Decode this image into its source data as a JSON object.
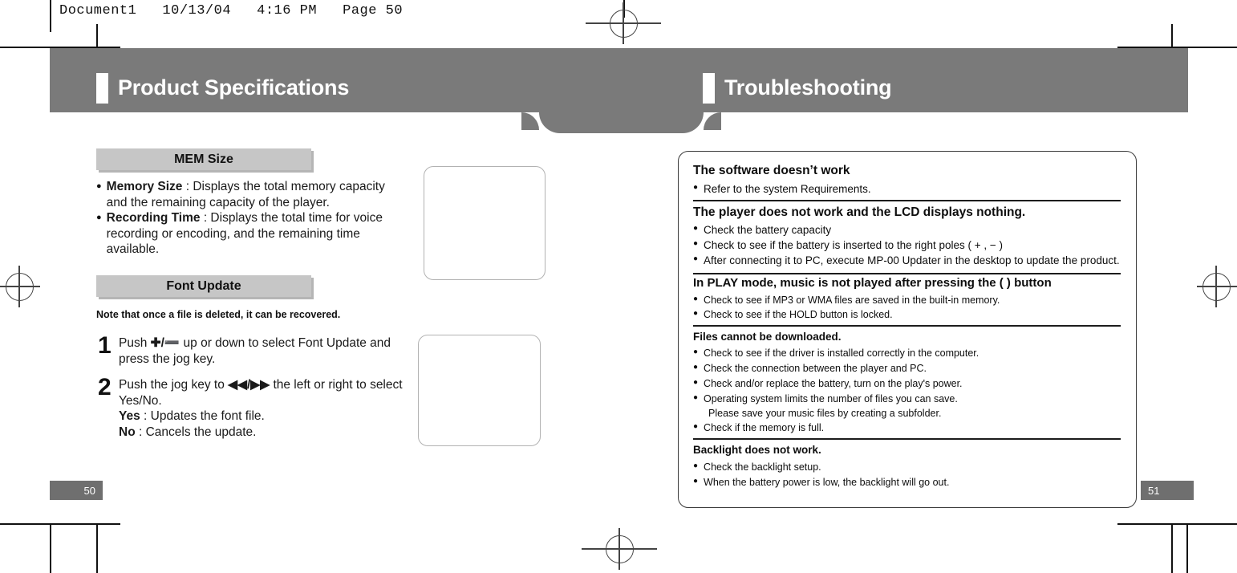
{
  "proof_header": {
    "text": "Document1   10/13/04   4:16 PM   Page 50"
  },
  "banner": {
    "left_title": "Product Specifications",
    "right_title": "Troubleshooting",
    "color": "#7a7a7a"
  },
  "left_page": {
    "page_number": "50",
    "sections": [
      {
        "heading": "MEM Size",
        "bullets": [
          {
            "dot": "●",
            "bold": "Memory Size",
            "rest": " : Displays the total memory capacity and the remaining capacity of the player."
          },
          {
            "dot": "●",
            "bold": "Recording Time",
            "rest": " : Displays the total time for voice recording or encoding, and the remaining time available."
          }
        ]
      },
      {
        "heading": "Font Update",
        "note": "Note that once a file is deleted, it can be recovered.",
        "steps": [
          {
            "num": "1",
            "pre": "Push ",
            "glyph": "✚/➖",
            "post": " up or down to select Font Update and press the jog key."
          },
          {
            "num": "2",
            "pre": "Push the jog key to ",
            "glyph": "◀◀/▶▶",
            "post": "  the left or right to select Yes/No.",
            "sub": [
              {
                "bold": "Yes",
                "rest": " : Updates the font file."
              },
              {
                "bold": "No",
                "rest": " : Cancels the update."
              }
            ]
          }
        ]
      }
    ],
    "placeholders": [
      {
        "name": "mem-size-screen-placeholder"
      },
      {
        "name": "font-update-screen-placeholder"
      }
    ]
  },
  "right_page": {
    "page_number": "51",
    "troubleshooting": [
      {
        "heading": "The software doesn’t work",
        "size": "large",
        "items": [
          {
            "dot": "●",
            "text": "Refer to the system Requirements."
          }
        ]
      },
      {
        "heading": "The player does not work and the LCD displays nothing.",
        "size": "large",
        "items": [
          {
            "dot": "●",
            "text": "Check the battery capacity"
          },
          {
            "dot": "●",
            "text": "Check to see if the battery is inserted to the right poles ( + , − )"
          },
          {
            "dot": "●",
            "text": "After connecting it to PC, execute MP-00 Updater in the desktop to update the product."
          }
        ]
      },
      {
        "heading": "In PLAY mode, music is not played after pressing the (    ) button",
        "size": "large",
        "items": [
          {
            "dot": "●",
            "text": "Check to see if MP3 or WMA  files are saved in the built-in memory."
          },
          {
            "dot": "●",
            "text": "Check to see if the HOLD button is locked."
          }
        ]
      },
      {
        "heading": "Files cannot be downloaded.",
        "size": "small",
        "items": [
          {
            "dot": "●",
            "text": "Check to see if the driver is installed correctly in the computer."
          },
          {
            "dot": "●",
            "text": "Check the connection between the player and PC."
          },
          {
            "dot": "●",
            "text": "Check and/or replace the battery, turn on the play's power."
          },
          {
            "dot": "●",
            "text": "Operating system limits the number of files you can save."
          },
          {
            "dot": "",
            "text": "Please save your music files by creating a subfolder."
          },
          {
            "dot": "●",
            "text": "Check if the memory is full."
          }
        ]
      },
      {
        "heading": "Backlight does not work.",
        "size": "small",
        "items": [
          {
            "dot": "●",
            "text": "Check the backlight setup."
          },
          {
            "dot": "●",
            "text": "When the battery power is low, the backlight will go out."
          }
        ]
      }
    ]
  }
}
